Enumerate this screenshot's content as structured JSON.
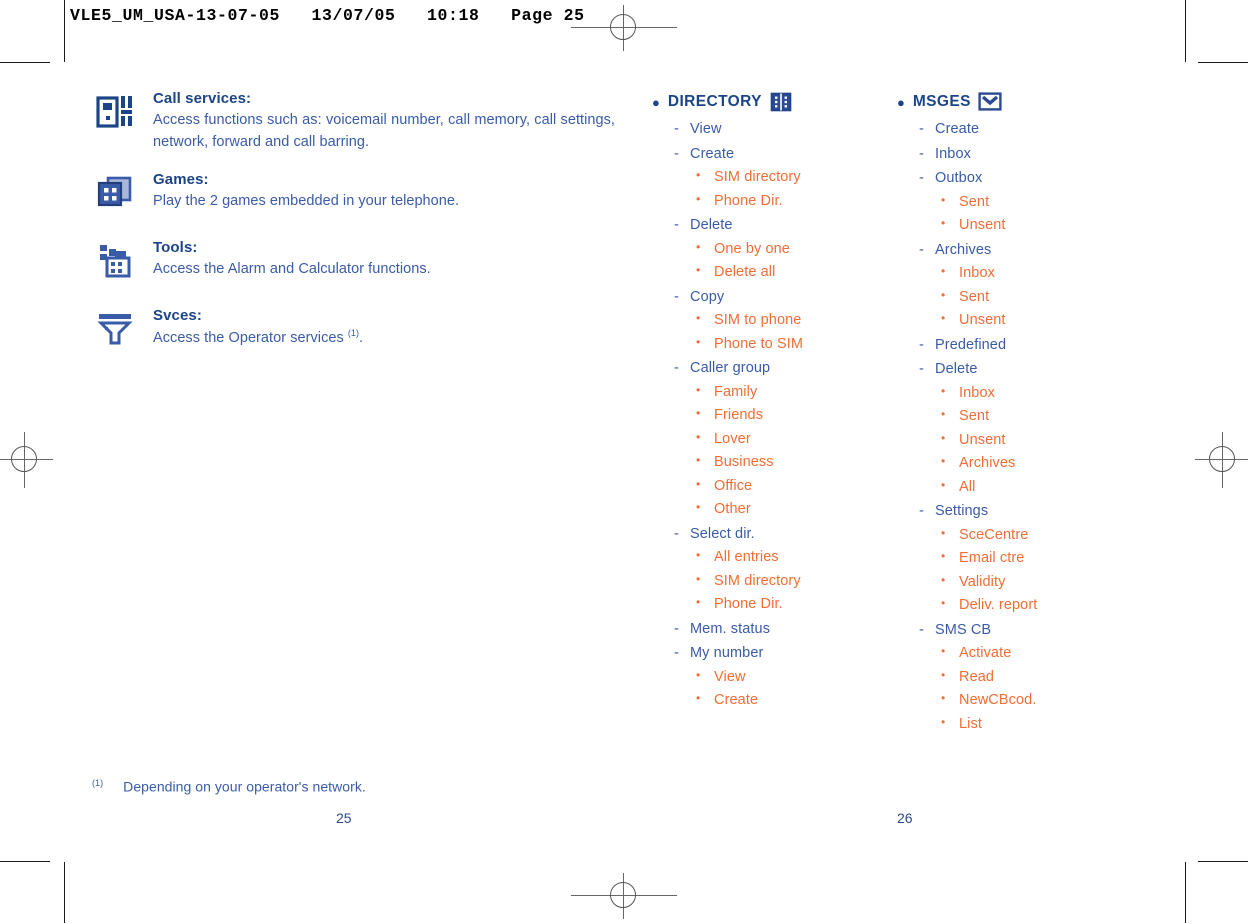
{
  "print_slug": "VLE5_UM_USA-13-07-05   13/07/05   10:18   Page 25",
  "colors": {
    "heading_navy": "#1c4587",
    "level1_blue": "#3a5ba8",
    "level2_orange": "#f26d35",
    "folio_blue": "#2b4a91"
  },
  "features": [
    {
      "icon": "call-services-icon",
      "title": "Call services:",
      "description": "Access functions such as: voicemail number, call memory, call settings, network, forward and call barring."
    },
    {
      "icon": "games-icon",
      "title": "Games:",
      "description": "Play the 2 games embedded in your telephone."
    },
    {
      "icon": "tools-icon",
      "title": "Tools:",
      "description": "Access the Alarm and Calculator functions."
    },
    {
      "icon": "services-icon",
      "title": "Svces:",
      "description_before": "Access the Operator services ",
      "footnote_mark": "(1)",
      "description_after": "."
    }
  ],
  "directory": {
    "title": "DIRECTORY",
    "icon": "directory-book-icon",
    "items": [
      {
        "label": "View",
        "children": []
      },
      {
        "label": "Create",
        "children": [
          "SIM directory",
          "Phone Dir."
        ]
      },
      {
        "label": "Delete",
        "children": [
          "One by one",
          "Delete all"
        ]
      },
      {
        "label": "Copy",
        "children": [
          "SIM to phone",
          "Phone to SIM"
        ]
      },
      {
        "label": "Caller group",
        "children": [
          "Family",
          "Friends",
          "Lover",
          "Business",
          "Office",
          "Other"
        ]
      },
      {
        "label": "Select dir.",
        "children": [
          "All entries",
          "SIM directory",
          "Phone Dir."
        ]
      },
      {
        "label": "Mem. status",
        "children": []
      },
      {
        "label": "My number",
        "children": [
          "View",
          "Create"
        ]
      }
    ]
  },
  "msges": {
    "title": "MSGES",
    "icon": "envelope-icon",
    "items": [
      {
        "label": "Create",
        "children": []
      },
      {
        "label": "Inbox",
        "children": []
      },
      {
        "label": "Outbox",
        "children": [
          "Sent",
          "Unsent"
        ]
      },
      {
        "label": "Archives",
        "children": [
          "Inbox",
          "Sent",
          "Unsent"
        ]
      },
      {
        "label": "Predefined",
        "children": []
      },
      {
        "label": "Delete",
        "children": [
          "Inbox",
          "Sent",
          "Unsent",
          "Archives",
          "All"
        ]
      },
      {
        "label": "Settings",
        "children": [
          "SceCentre",
          "Email ctre",
          "Validity",
          "Deliv. report"
        ]
      },
      {
        "label": "SMS CB",
        "children": [
          "Activate",
          "Read",
          "NewCBcod.",
          "List"
        ]
      }
    ]
  },
  "footnote": {
    "mark": "(1)",
    "text": "Depending on your operator's network."
  },
  "folios": {
    "left": "25",
    "right": "26"
  }
}
